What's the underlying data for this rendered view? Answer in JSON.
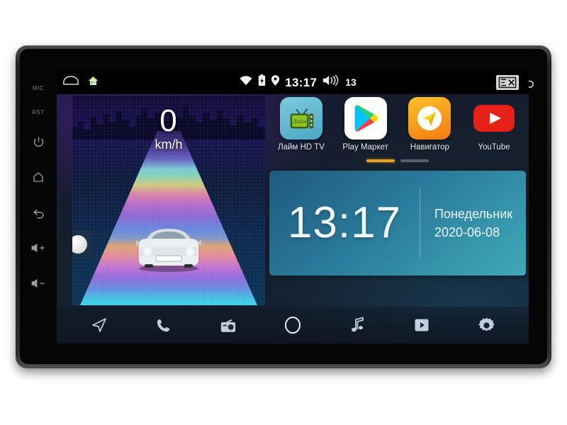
{
  "device": {
    "name": "car-head-unit",
    "bezel_buttons": [
      {
        "name": "mic-label",
        "label": "MIC",
        "type": "text"
      },
      {
        "name": "reset-label",
        "label": "RST",
        "type": "text"
      },
      {
        "name": "power-button",
        "label": "power-icon",
        "type": "icon"
      },
      {
        "name": "home-button",
        "label": "home-icon",
        "type": "icon"
      },
      {
        "name": "back-button",
        "label": "back-arrow-icon",
        "type": "icon"
      },
      {
        "name": "volume-up",
        "label": "volume-up-icon",
        "type": "icon"
      },
      {
        "name": "volume-down",
        "label": "volume-down-icon",
        "type": "icon"
      }
    ],
    "system_keys": [
      {
        "name": "recent-apps-key",
        "label": "recent-apps-icon"
      },
      {
        "name": "back-key",
        "label": "back-arrow-icon"
      }
    ]
  },
  "statusbar": {
    "left_icons": [
      {
        "name": "screenshot-icon",
        "label": "screenshot-icon"
      },
      {
        "name": "home-app-icon",
        "label": "house-icon"
      }
    ],
    "wifi_icon": "wifi-icon",
    "battery_icon": "battery-icon",
    "location_icon": "location-pin-icon",
    "time": "13:17",
    "volume_icon": "volume-icon",
    "volume_level": "13",
    "cast_icon": "screen-cast-off-icon"
  },
  "speedometer": {
    "value": "0",
    "unit": "km/h",
    "handle_icon": "home-handle-icon"
  },
  "apps": [
    {
      "name": "lime-hd-tv",
      "label": "Лайм HD TV",
      "icon": "tv-icon",
      "icon_class": "ic-lime"
    },
    {
      "name": "play-market",
      "label": "Play Маркет",
      "icon": "play-store-icon",
      "icon_class": "ic-play"
    },
    {
      "name": "navigator",
      "label": "Навигатор",
      "icon": "navigation-arrow-icon",
      "icon_class": "ic-nav"
    },
    {
      "name": "youtube",
      "label": "YouTube",
      "icon": "youtube-icon",
      "icon_class": "ic-yt"
    }
  ],
  "page_indicator": {
    "pages": 2,
    "active": 1,
    "active_color": "#e9a21c",
    "idle_color": "#56616f"
  },
  "clock_widget": {
    "time": "13:17",
    "weekday": "Понедельник",
    "date": "2020-06-08"
  },
  "dock": [
    {
      "name": "dock-navigation",
      "icon": "navigation-arrow-icon"
    },
    {
      "name": "dock-phone",
      "icon": "phone-icon"
    },
    {
      "name": "dock-radio",
      "icon": "radio-icon"
    },
    {
      "name": "dock-home",
      "icon": "home-circle-icon"
    },
    {
      "name": "dock-music",
      "icon": "music-note-icon"
    },
    {
      "name": "dock-video",
      "icon": "video-play-icon"
    },
    {
      "name": "dock-settings",
      "icon": "gear-icon"
    }
  ],
  "colors": {
    "accent": "#e9a21c",
    "widget_teal": "#2a7b9b",
    "wallpaper": "#16202f",
    "youtube_red": "#e62117"
  }
}
